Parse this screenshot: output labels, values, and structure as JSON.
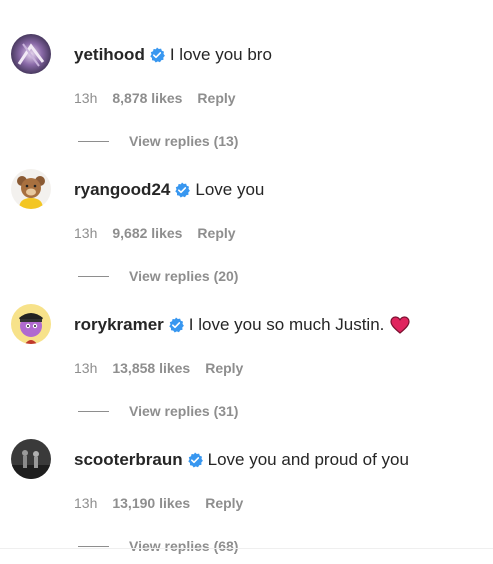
{
  "comments": [
    {
      "username": "yetihood",
      "text": "I love you bro",
      "time": "13h",
      "likes": "8,878 likes",
      "reply_label": "Reply",
      "view_replies": "View replies (13)",
      "avatar_icon": "avatar-yetihood",
      "verified": true
    },
    {
      "username": "ryangood24",
      "text": "Love you",
      "time": "13h",
      "likes": "9,682 likes",
      "reply_label": "Reply",
      "view_replies": "View replies (20)",
      "avatar_icon": "avatar-ryangood24",
      "verified": true
    },
    {
      "username": "rorykramer",
      "text": "I love you so much Justin.",
      "emoji": "red-heart",
      "time": "13h",
      "likes": "13,858 likes",
      "reply_label": "Reply",
      "view_replies": "View replies (31)",
      "avatar_icon": "avatar-rorykramer",
      "verified": true
    },
    {
      "username": "scooterbraun",
      "text": "Love you and proud of you",
      "time": "13h",
      "likes": "13,190 likes",
      "reply_label": "Reply",
      "view_replies": "View replies (68)",
      "avatar_icon": "avatar-scooterbraun",
      "verified": true
    }
  ],
  "colors": {
    "text": "#262626",
    "secondary": "#8e8e8e",
    "verified_blue": "#3897f0",
    "heart_red": "#e0245e"
  }
}
